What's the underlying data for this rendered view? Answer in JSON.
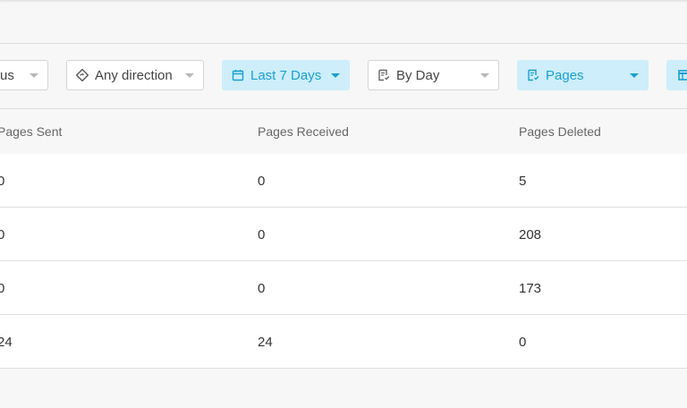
{
  "filters": {
    "status_partial": "us",
    "direction": "Any direction",
    "date_range": "Last 7 Days",
    "grouping": "By Day",
    "metric": "Pages"
  },
  "table": {
    "columns": [
      "Pages Sent",
      "Pages Received",
      "Pages Deleted"
    ],
    "rows": [
      [
        "0",
        "0",
        "5"
      ],
      [
        "0",
        "0",
        "208"
      ],
      [
        "0",
        "0",
        "173"
      ],
      [
        "24",
        "24",
        "0"
      ]
    ]
  },
  "colors": {
    "accent": "#1b9fcf",
    "accent_bg": "#cdeefa",
    "background": "#f7f7f7"
  }
}
